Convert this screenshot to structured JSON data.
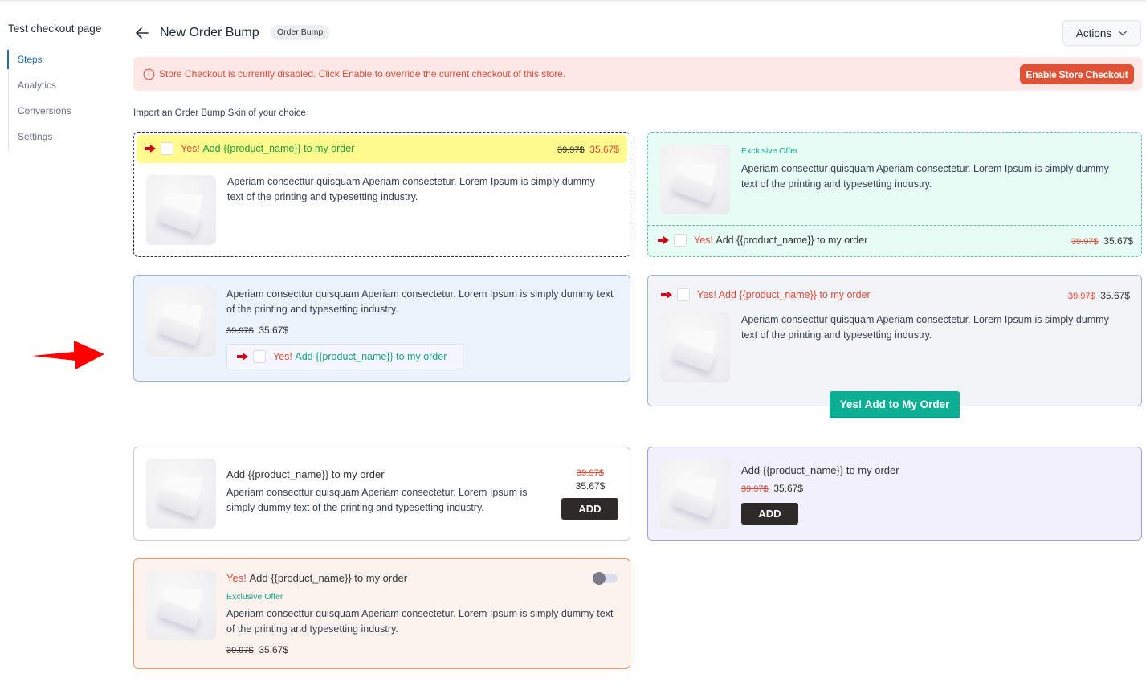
{
  "sidebar": {
    "title": "Test checkout page",
    "items": [
      {
        "label": "Steps",
        "active": true
      },
      {
        "label": "Analytics",
        "active": false
      },
      {
        "label": "Conversions",
        "active": false
      },
      {
        "label": "Settings",
        "active": false
      }
    ]
  },
  "header": {
    "back_icon": "arrow-left-icon",
    "title": "New Order Bump",
    "badge": "Order Bump",
    "actions_label": "Actions"
  },
  "alert": {
    "icon": "info-circle-icon",
    "text": "Store Checkout is currently disabled. Click Enable to override the current checkout of this store.",
    "button_label": "Enable Store Checkout"
  },
  "import_label": "Import an Order Bump Skin of your choice",
  "skins": {
    "common": {
      "yes": "Yes!",
      "add_text": "Add {{product_name}} to my order",
      "full_cta": "Yes! Add {{product_name}} to my order",
      "plain_cta": "Add {{product_name}} to my order",
      "description": "Aperiam consecttur quisquam Aperiam consectetur. Lorem Ipsum is simply dummy text of the printing and typesetting industry.",
      "old_price": "39.97$",
      "new_price": "35.67$",
      "exclusive": "Exclusive Offer",
      "add_button": "ADD",
      "big_button": "Yes! Add to My Order"
    },
    "colors": {
      "skin1_bg": "#fefb8e",
      "skin2_bg": "#e8fcf6",
      "skin3_bg": "#edf3fd",
      "skin4_bg": "#f3f4f8",
      "skin6_bg": "#f1f0fc",
      "skin7_bg": "#fdf3ee",
      "accent_red": "#dd4b39",
      "accent_teal": "#17a38a"
    },
    "skin7_toggle_on": false
  },
  "annotation": {
    "icon": "red-pointer-arrow-icon"
  }
}
